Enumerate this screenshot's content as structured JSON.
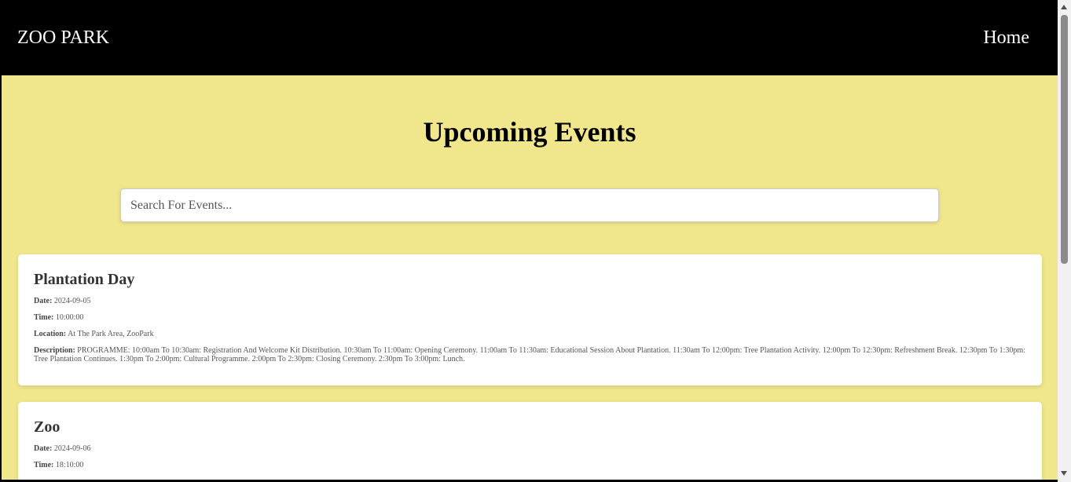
{
  "nav": {
    "brand": "ZOO PARK",
    "home_label": "Home"
  },
  "main": {
    "title": "Upcoming Events",
    "search": {
      "placeholder": "Search For Events...",
      "value": ""
    }
  },
  "labels": {
    "date": "Date:",
    "time": "Time:",
    "location": "Location:",
    "description": "Description:"
  },
  "events": [
    {
      "title": "Plantation Day",
      "date": "2024-09-05",
      "time": "10:00:00",
      "location": "At The Park Area, ZooPark",
      "description": "PROGRAMME: 10:00am To 10:30am: Registration And Welcome Kit Distribution. 10:30am To 11:00am: Opening Ceremony. 11:00am To 11:30am: Educational Session About Plantation. 11:30am To 12:00pm: Tree Plantation Activity. 12:00pm To 12:30pm: Refreshment Break. 12:30pm To 1:30pm: Tree Plantation Continues. 1:30pm To 2:00pm: Cultural Programme. 2:00pm To 2:30pm: Closing Ceremony. 2:30pm To 3:00pm: Lunch."
    },
    {
      "title": "Zoo",
      "date": "2024-09-06",
      "time": "18:10:00"
    }
  ]
}
